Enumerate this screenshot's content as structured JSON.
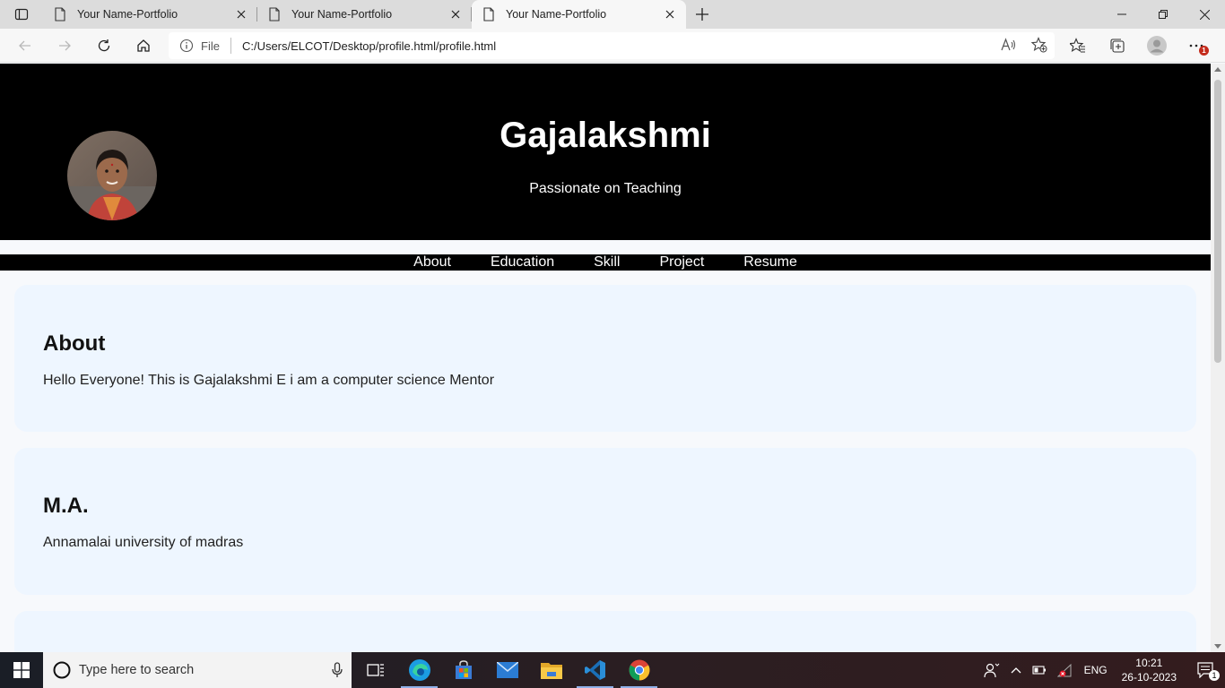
{
  "browser": {
    "tabs": [
      {
        "title": "Your Name-Portfolio",
        "active": false
      },
      {
        "title": "Your Name-Portfolio",
        "active": false
      },
      {
        "title": "Your Name-Portfolio",
        "active": true
      }
    ],
    "address": {
      "scheme_label": "File",
      "url": "C:/Users/ELCOT/Desktop/profile.html/profile.html"
    },
    "notification_badge": "1"
  },
  "page": {
    "header": {
      "name": "Gajalakshmi",
      "tagline": "Passionate on Teaching"
    },
    "nav": [
      "About",
      "Education",
      "Skill",
      "Project",
      "Resume"
    ],
    "sections": [
      {
        "heading": "About",
        "text": "Hello Everyone! This is Gajalakshmi E i am a computer science Mentor"
      },
      {
        "heading": "M.A.",
        "text": "Annamalai university of madras"
      }
    ]
  },
  "taskbar": {
    "search_placeholder": "Type here to search",
    "language": "ENG",
    "time": "10:21",
    "date": "26-10-2023",
    "notification_count": "1"
  }
}
